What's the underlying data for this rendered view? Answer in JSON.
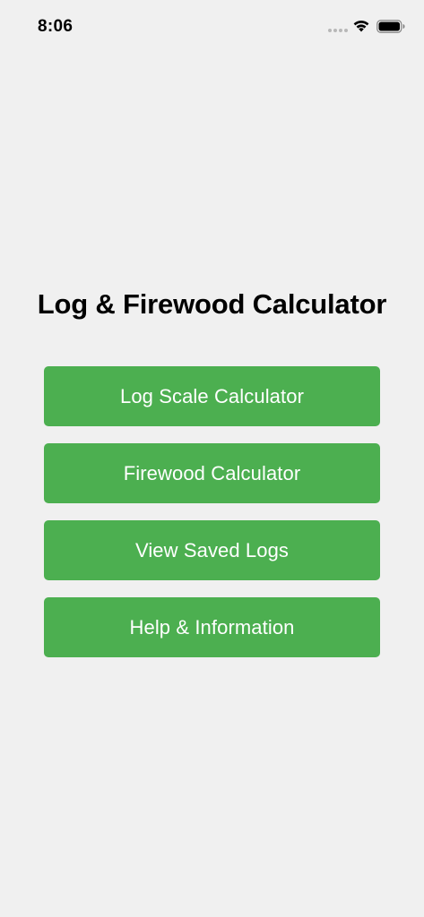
{
  "status_bar": {
    "time": "8:06",
    "icons": [
      "signal-dots-icon",
      "wifi-icon",
      "battery-icon"
    ]
  },
  "title": "Log & Firewood Calculator",
  "menu": {
    "buttons": [
      {
        "label": "Log Scale Calculator"
      },
      {
        "label": "Firewood Calculator"
      },
      {
        "label": "View Saved Logs"
      },
      {
        "label": "Help & Information"
      }
    ]
  },
  "colors": {
    "background": "#f0f0f0",
    "button_green": "#4caf50",
    "button_text": "#ffffff",
    "title_text": "#000000"
  }
}
